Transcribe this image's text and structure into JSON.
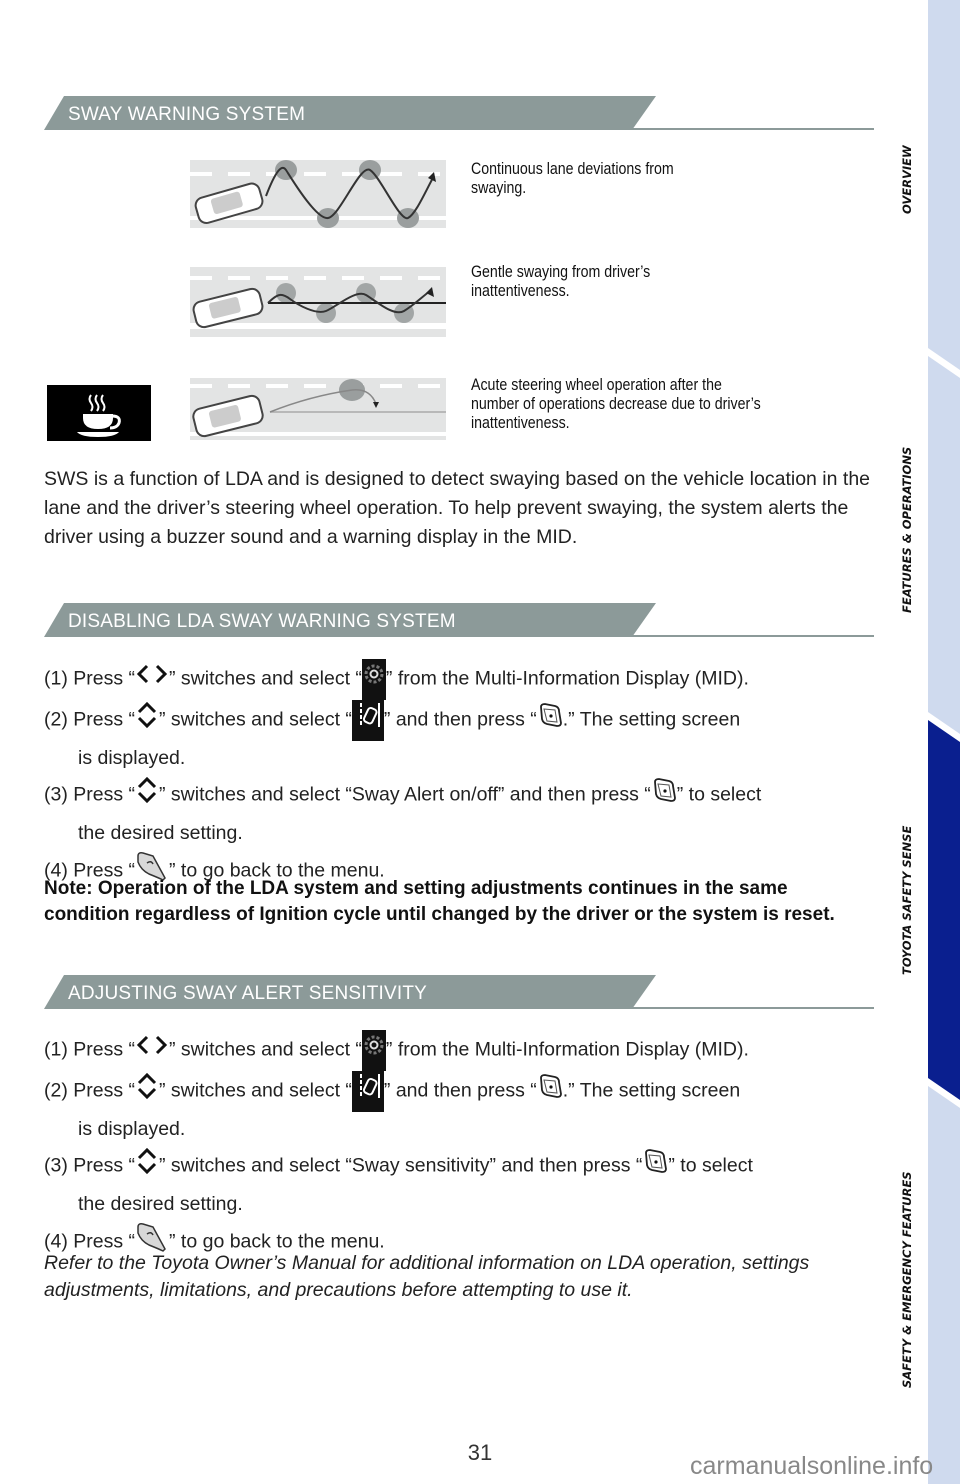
{
  "tabs": {
    "items": [
      {
        "label": "OVERVIEW",
        "active": false
      },
      {
        "label": "FEATURES & OPERATIONS",
        "active": false
      },
      {
        "label": "TOYOTA SAFETY SENSE",
        "active": true
      },
      {
        "label": "SAFETY & EMERGENCY FEATURES",
        "active": false
      }
    ],
    "colors": {
      "inactive": "#cfdaee",
      "active": "#0a1f8f"
    }
  },
  "sections": {
    "sway": {
      "title": "SWAY WARNING SYSTEM",
      "diagrams": [
        {
          "caption": "Continuous lane deviations from swaying."
        },
        {
          "caption": "Gentle swaying from driver’s inattentiveness."
        },
        {
          "caption": "Acute steering wheel operation after the number of operations decrease due to driver’s inattentiveness."
        }
      ],
      "captions_lines": [
        [
          "Continuous lane deviations from",
          "swaying."
        ],
        [
          "Gentle swaying from driver’s",
          "inattentiveness."
        ],
        [
          "Acute steering wheel operation after the",
          "number of operations decrease due to driver’s",
          "inattentiveness."
        ]
      ],
      "icon": "coffee-cup-icon",
      "body": "SWS is a function of LDA and is designed to detect swaying based on the vehicle location in the lane and the driver’s steering wheel operation. To help prevent swaying, the system alerts the driver using a buzzer sound and a warning display in the MID."
    },
    "disabling": {
      "title": "DISABLING LDA SWAY WARNING SYSTEM",
      "steps": {
        "s1": {
          "pre": "(1) Press “",
          "mid1": "” switches and select “",
          "post": "” from the Multi-Information Display (MID)."
        },
        "s2": {
          "pre": "(2) Press “",
          "mid1": "” switches and select “",
          "mid2": "” and then press “",
          "post": ".” The setting screen",
          "cont": "is displayed."
        },
        "s3": {
          "pre": "(3) Press “",
          "mid1": "” switches and select “Sway Alert on/off” and then press “",
          "post": "” to select",
          "cont": "the desired setting."
        },
        "s4": {
          "pre": "(4) Press “",
          "post": "” to go back to the menu."
        }
      },
      "note": "Note: Operation of the LDA system and setting adjustments continues in the same condition regardless of Ignition cycle until changed by the driver or the system is reset."
    },
    "adjusting": {
      "title": "ADJUSTING SWAY ALERT SENSITIVITY",
      "steps": {
        "s1": {
          "pre": "(1) Press “",
          "mid1": "” switches and select “",
          "post": "” from the Multi-Information Display (MID)."
        },
        "s2": {
          "pre": "(2) Press “",
          "mid1": "” switches and select “",
          "mid2": "” and then press “",
          "post": ".” The setting screen",
          "cont": "is displayed."
        },
        "s3": {
          "pre": "(3) Press “",
          "mid1": "” switches and select “Sway sensitivity” and then press “",
          "post": "” to select",
          "cont": "the desired setting."
        },
        "s4": {
          "pre": "(4) Press “",
          "post": "” to go back to the menu."
        }
      },
      "refer": "Refer to the Toyota Owner’s Manual for additional information on LDA operation, settings adjustments, limitations, and precautions before attempting to use it."
    }
  },
  "footer": {
    "page_number": "31",
    "watermark": "carmanualsonline.info"
  },
  "colors": {
    "section_band": "#8c9a99",
    "diagram_bg": "#e3e4e4"
  }
}
